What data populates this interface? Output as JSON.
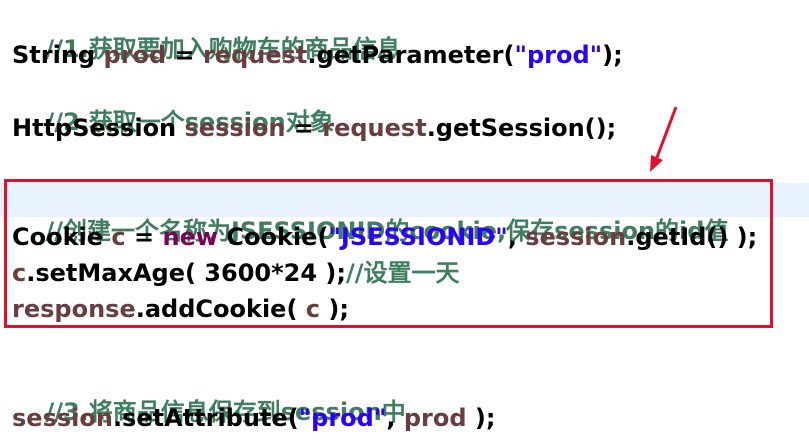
{
  "colors": {
    "comment": "#3f7f5f",
    "variable": "#6a3e3e",
    "string": "#2a00ff",
    "keyword": "#7f0055",
    "highlight_box": "#e3102a",
    "line_highlight": "#e8f2fe"
  },
  "code": {
    "l1": {
      "comment": "//1.获取要加入购物车的商品信息"
    },
    "l2": {
      "type": "String ",
      "var": "prod",
      "eq": " = ",
      "obj": "request",
      "call": ".getParameter(",
      "str": "\"prod\"",
      "end": ");"
    },
    "l3": {
      "comment": "//2.获取一个session对象"
    },
    "l4": {
      "type": "HttpSession ",
      "var": "session",
      "eq": " = ",
      "obj": "request",
      "call": ".getSession();"
    },
    "l5": {
      "comment": "//创建一个名称为JSESSIONID的cookie,保存session的id值"
    },
    "l6": {
      "type": "Cookie ",
      "var": "c",
      "eq": " = ",
      "kw": "new",
      "ctor": " Cookie(",
      "str": "\"JSESSIONID\"",
      "comma": ", ",
      "obj": "session",
      "call": ".getId() );"
    },
    "l7": {
      "var": "c",
      "call": ".setMaxAge( 3600*24 );",
      "comment": "//设置一天"
    },
    "l8": {
      "obj": "response",
      "call": ".addCookie( ",
      "var": "c",
      "end": " );"
    },
    "l9": {
      "comment": "//3.将商品信息保存到session中"
    },
    "l10": {
      "obj": "session",
      "call": ".setAttribute(",
      "str": "\"prod\"",
      "comma": ", ",
      "var": "prod",
      "end": " );"
    }
  }
}
